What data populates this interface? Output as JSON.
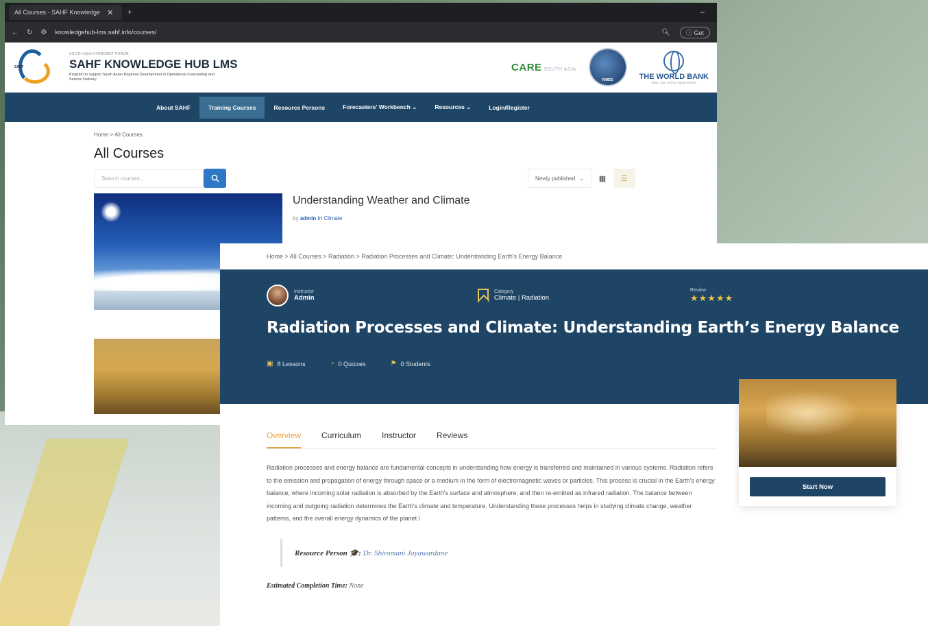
{
  "browser": {
    "tab_title": "All Courses - SAHF Knowledge",
    "url": "knowledgehub-lms.sahf.info/courses/",
    "profile_label": "Get"
  },
  "header": {
    "small_text": "SOUTH ASIA HYDROMET FORUM",
    "title": "SAHF KNOWLEDGE HUB LMS",
    "subtitle": "Program to support South Asian Regional Development in Operational Forecasting and Service Delivery",
    "logo_text": "SAHF",
    "partner_care": "CARE",
    "partner_care_sub": "SOUTH ASIA",
    "partner_rimes": "RIMES",
    "partner_wb": "THE WORLD BANK",
    "partner_wb_sub": "IBRD • IDA | WORLD BANK GROUP"
  },
  "nav": [
    "About SAHF",
    "Training Courses",
    "Resource Persons",
    "Forecasters' Workbench ⌄",
    "Resources ⌄",
    "Login/Register"
  ],
  "courses_page": {
    "breadcrumb": "Home > All Courses",
    "title": "All Courses",
    "search_placeholder": "Search courses...",
    "sort_label": "Newly published",
    "course1": {
      "title": "Understanding Weather and Climate",
      "by": "by",
      "author": "admin",
      "in": "In",
      "category": "Climate"
    }
  },
  "course_page": {
    "breadcrumb": "Home > All Courses > Radiation > Radiation Processes and Climate: Understanding Earth's Energy Balance",
    "instructor_label": "Instructor",
    "instructor_name": "Admin",
    "category_label": "Category",
    "category_value": "Climate | Radiation",
    "review_label": "Review",
    "stars": "★★★★★",
    "title": "Radiation Processes and Climate: Understanding Earth’s Energy Balance",
    "lessons": "8 Lessons",
    "quizzes": "0 Quizzes",
    "students": "0 Students",
    "tabs": [
      "Overview",
      "Curriculum",
      "Instructor",
      "Reviews"
    ],
    "description": "Radiation processes and energy balance are fundamental concepts in understanding how energy is transferred and maintained in various systems. Radiation refers to the emission and propagation of energy through space or a medium in the form of electromagnetic waves or particles. This process is crucial in the Earth's energy balance, where incoming solar radiation is absorbed by the Earth's surface and atmosphere, and then re-emitted as infrared radiation. The balance between incoming and outgoing radiation determines the Earth's climate and temperature. Understanding these processes helps in studying climate change, weather patterns, and the overall energy dynamics of the planet.\\",
    "resource_person_label": "Resource Person 🎓:",
    "resource_person": "Dr. Shiromani Jayawardane",
    "est_label": "Estimated Completion Time:",
    "est_value": "None",
    "start_button": "Start Now"
  }
}
